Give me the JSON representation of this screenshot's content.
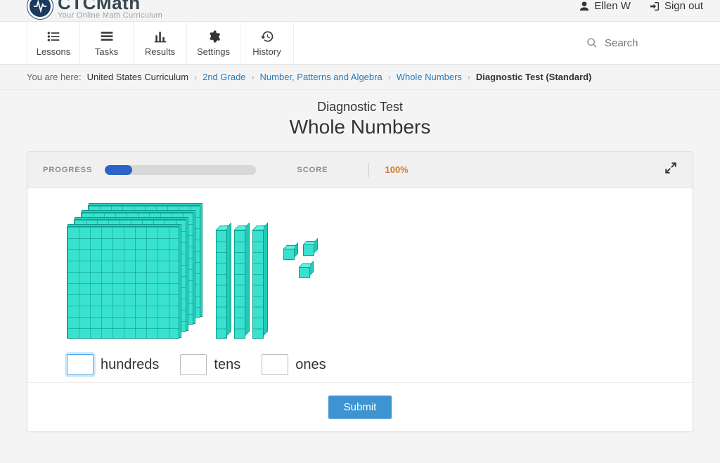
{
  "brand": {
    "title": "CTCMath",
    "tagline": "Your Online Math Curriculum"
  },
  "user": {
    "name": "Ellen W",
    "signout": "Sign out"
  },
  "nav": {
    "lessons": "Lessons",
    "tasks": "Tasks",
    "results": "Results",
    "settings": "Settings",
    "history": "History",
    "search_placeholder": "Search"
  },
  "breadcrumb": {
    "label": "You are here:",
    "items": [
      {
        "text": "United States Curriculum",
        "link": false
      },
      {
        "text": "2nd Grade",
        "link": true
      },
      {
        "text": "Number, Patterns and Algebra",
        "link": true
      },
      {
        "text": "Whole Numbers",
        "link": true
      },
      {
        "text": "Diagnostic Test (Standard)",
        "link": false,
        "current": true
      }
    ]
  },
  "page": {
    "subtitle": "Diagnostic Test",
    "title": "Whole Numbers"
  },
  "progress": {
    "label": "PROGRESS",
    "percent": 18
  },
  "score": {
    "label": "SCORE",
    "value": "100%"
  },
  "question": {
    "hundreds_count": 4,
    "tens_count": 3,
    "ones_count": 3,
    "labels": {
      "hundreds": "hundreds",
      "tens": "tens",
      "ones": "ones"
    },
    "inputs": {
      "hundreds": "",
      "tens": "",
      "ones": ""
    }
  },
  "buttons": {
    "submit": "Submit"
  }
}
